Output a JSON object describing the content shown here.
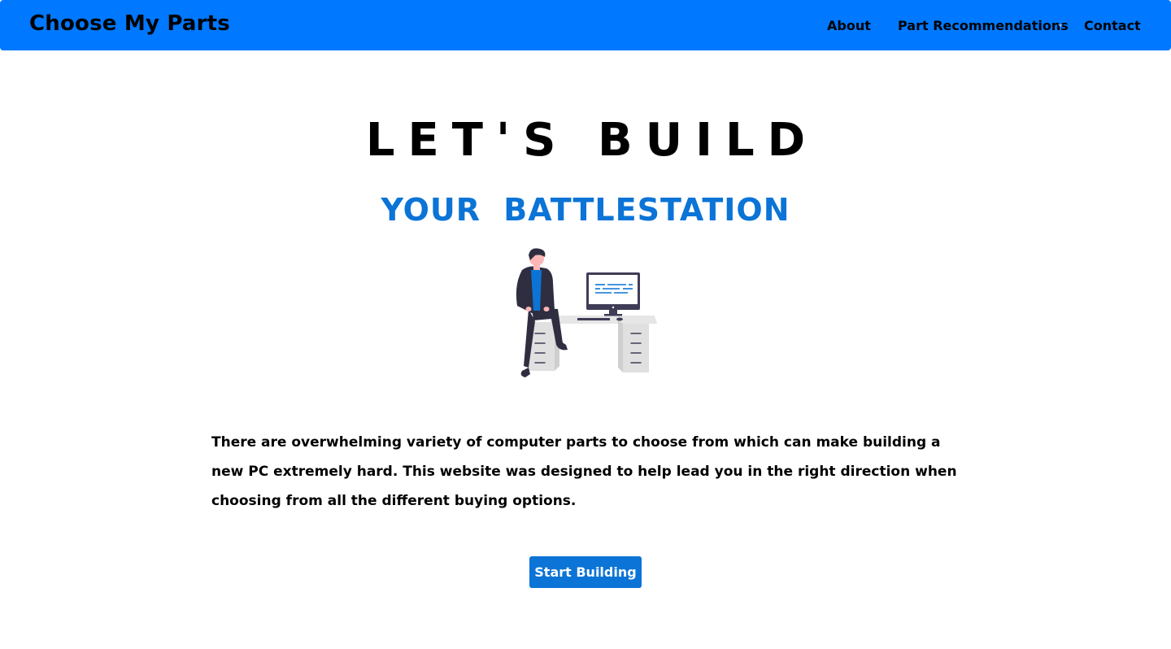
{
  "navbar": {
    "brand": "Choose My Parts",
    "links": {
      "about": "About",
      "part_recommendations": "Part Recommendations",
      "contact": "Contact"
    },
    "dropdown_icon": "caret-down-icon",
    "background_color": "#0078ff"
  },
  "hero": {
    "title": "LET'S BUILD",
    "subtitle": "YOUR BATTLESTATION",
    "subtitle_color": "#0b74d6",
    "illustration": "person-at-desk-computer-illustration"
  },
  "intro": {
    "text": "There are overwhelming variety of computer parts to choose from which can make building a new PC extremely hard. This website was designed to help lead you in the right direction when choosing from all the different buying options."
  },
  "cta": {
    "label": "Start Building",
    "color": "#0b74d6"
  }
}
